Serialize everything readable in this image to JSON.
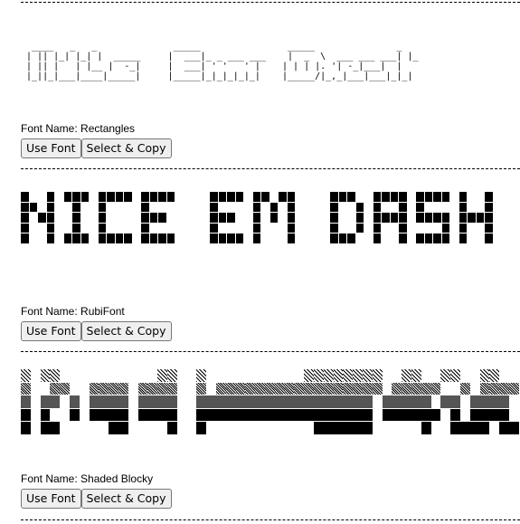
{
  "fonts": [
    {
      "art": "  ____   _   _              _____                _____               _\n | || |_| |_| |  _____     |  ___|_ _ ___ ___    |  _  \\  ___ ___ ___| |_\n | || |   | |__ |  -_|     |  ___| ' '   ' |    | | | |. '| -_|___|  |\n |_||_|___|____|_____|     |_____|_|_|_|_|_|    |_____/|_,_|___|___|_|_|",
      "name_label": "Font Name: Rectangles"
    },
    {
      "art_text": "NICE EM DASH",
      "name_label": "Font Name: RubiFont"
    },
    {
      "art_text": "Nice Em Dash",
      "name_label": "Font Name: Shaded Blocky"
    }
  ],
  "buttons": {
    "use_font": "Use Font",
    "select_copy": "Select & Copy"
  }
}
